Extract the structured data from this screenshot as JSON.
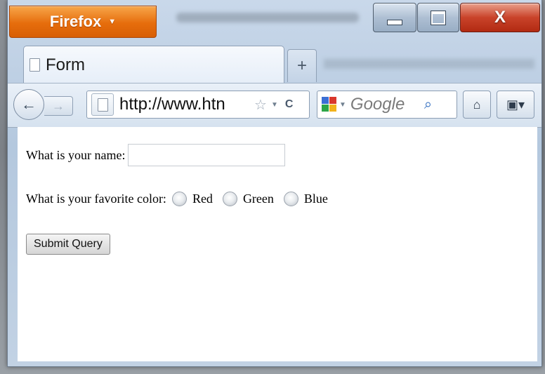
{
  "window": {
    "app_button_label": "Firefox",
    "close_glyph": "X"
  },
  "tabs": [
    {
      "label": "Form",
      "active": true
    }
  ],
  "new_tab_glyph": "+",
  "navbar": {
    "url": "http://www.htn",
    "search_placeholder": "Google",
    "icons": [
      "back-arrow-icon",
      "forward-arrow-icon",
      "page-icon",
      "star-icon",
      "reload-icon",
      "google-icon",
      "search-icon",
      "home-icon",
      "bookmarks-icon"
    ]
  },
  "form": {
    "name_label": "What is your name:",
    "name_value": "",
    "color_label": "What is your favorite color:",
    "color_options": [
      "Red",
      "Green",
      "Blue"
    ],
    "submit_label": "Submit Query"
  },
  "colors": {
    "firefox_orange": "#e66d0c",
    "close_red": "#c9432a",
    "chrome_blue": "#c9d8ea"
  }
}
